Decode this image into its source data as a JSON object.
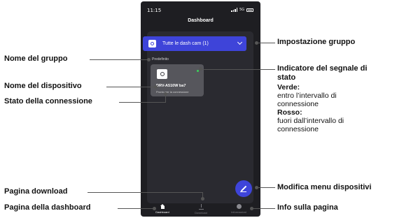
{
  "status_bar": {
    "time": "11:15",
    "network": "5G"
  },
  "header": {
    "title": "Dashboard"
  },
  "group_selector": {
    "label": "Tutte le dash cam (1)"
  },
  "group": {
    "name": "Predefinito"
  },
  "device": {
    "name": "DRV-A510W ba7",
    "status": "Pronto per la connessione",
    "signal_color": "#3ad35b"
  },
  "bottom_nav": [
    {
      "label": "Dashboard",
      "icon": "home-icon",
      "active": true
    },
    {
      "label": "Download",
      "icon": "download-icon",
      "active": false
    },
    {
      "label": "Informazioni",
      "icon": "info-icon",
      "active": false
    }
  ],
  "fab": {
    "icon": "pencil-icon"
  },
  "annotations": {
    "group_setting": "Impostazione gruppo",
    "group_name": "Nome del gruppo",
    "signal_indicator_line1": "Indicatore del segnale di",
    "signal_indicator_line2": "stato",
    "green_label": "Verde:",
    "green_desc_line1": "entro l’intervallo di",
    "green_desc_line2": "connessione",
    "red_label": "Rosso:",
    "red_desc_line1": "fuori dall’intervallo di",
    "red_desc_line2": "connessione",
    "device_name": "Nome del dispositivo",
    "connection_status": "Stato della connessione",
    "edit_menu": "Modifica menu dispositivi",
    "download_page": "Pagina download",
    "dashboard_page": "Pagina della dashboard",
    "info_page": "Info sulla pagina"
  },
  "colors": {
    "accent": "#3e44d9",
    "phone_bg": "#1e1e22",
    "panel_bg": "#2a2a30",
    "card_bg": "#56565c"
  }
}
